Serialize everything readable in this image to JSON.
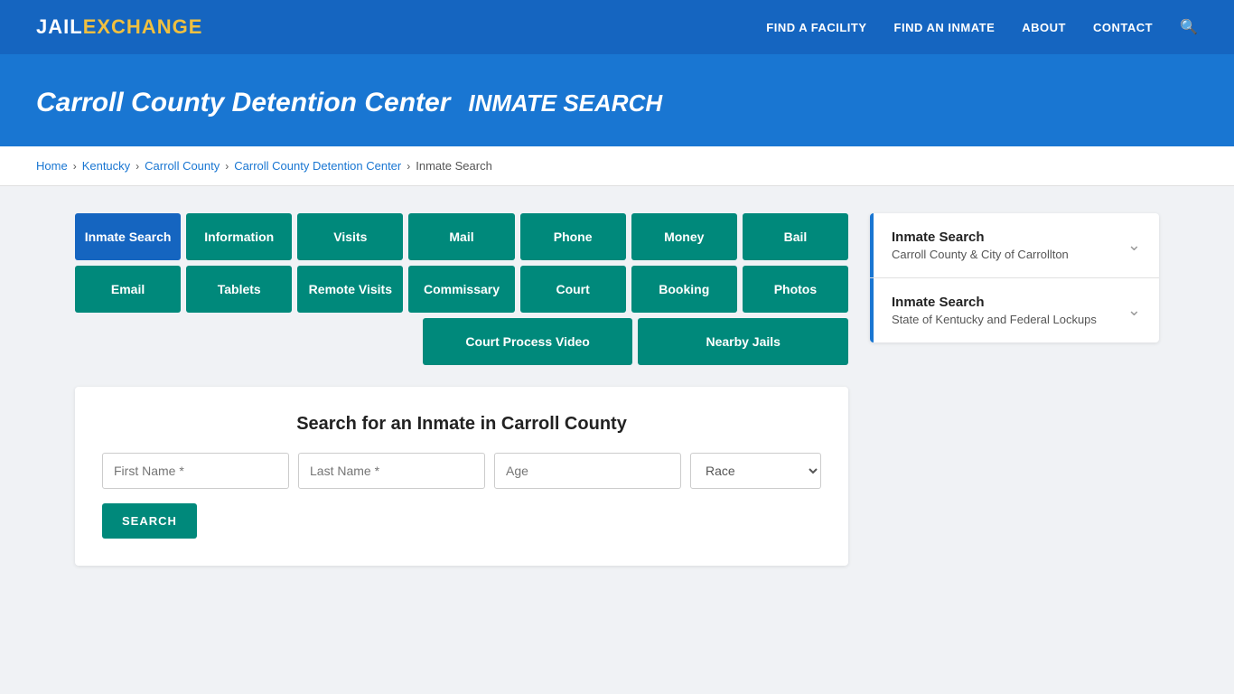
{
  "header": {
    "logo_jail": "JAIL",
    "logo_exchange": "EXCHANGE",
    "nav": [
      {
        "label": "FIND A FACILITY",
        "name": "find-facility"
      },
      {
        "label": "FIND AN INMATE",
        "name": "find-inmate"
      },
      {
        "label": "ABOUT",
        "name": "about"
      },
      {
        "label": "CONTACT",
        "name": "contact"
      }
    ]
  },
  "hero": {
    "facility_name": "Carroll County Detention Center",
    "page_type": "INMATE SEARCH"
  },
  "breadcrumb": {
    "items": [
      {
        "label": "Home",
        "name": "home"
      },
      {
        "label": "Kentucky",
        "name": "kentucky"
      },
      {
        "label": "Carroll County",
        "name": "carroll-county"
      },
      {
        "label": "Carroll County Detention Center",
        "name": "detention-center"
      },
      {
        "label": "Inmate Search",
        "name": "inmate-search-crumb"
      }
    ]
  },
  "nav_buttons": {
    "row1": [
      {
        "label": "Inmate Search",
        "active": true,
        "name": "btn-inmate-search"
      },
      {
        "label": "Information",
        "active": false,
        "name": "btn-information"
      },
      {
        "label": "Visits",
        "active": false,
        "name": "btn-visits"
      },
      {
        "label": "Mail",
        "active": false,
        "name": "btn-mail"
      },
      {
        "label": "Phone",
        "active": false,
        "name": "btn-phone"
      },
      {
        "label": "Money",
        "active": false,
        "name": "btn-money"
      },
      {
        "label": "Bail",
        "active": false,
        "name": "btn-bail"
      }
    ],
    "row2": [
      {
        "label": "Email",
        "active": false,
        "name": "btn-email"
      },
      {
        "label": "Tablets",
        "active": false,
        "name": "btn-tablets"
      },
      {
        "label": "Remote Visits",
        "active": false,
        "name": "btn-remote-visits"
      },
      {
        "label": "Commissary",
        "active": false,
        "name": "btn-commissary"
      },
      {
        "label": "Court",
        "active": false,
        "name": "btn-court"
      },
      {
        "label": "Booking",
        "active": false,
        "name": "btn-booking"
      },
      {
        "label": "Photos",
        "active": false,
        "name": "btn-photos"
      }
    ],
    "row3": [
      {
        "label": "Court Process Video",
        "active": false,
        "name": "btn-court-process-video"
      },
      {
        "label": "Nearby Jails",
        "active": false,
        "name": "btn-nearby-jails"
      }
    ]
  },
  "search_form": {
    "title": "Search for an Inmate in Carroll County",
    "fields": {
      "first_name_placeholder": "First Name *",
      "last_name_placeholder": "Last Name *",
      "age_placeholder": "Age",
      "race_placeholder": "Race"
    },
    "search_button_label": "SEARCH"
  },
  "sidebar": {
    "items": [
      {
        "title": "Inmate Search",
        "subtitle": "Carroll County & City of Carrollton",
        "name": "sidebar-inmate-search-1"
      },
      {
        "title": "Inmate Search",
        "subtitle": "State of Kentucky and Federal Lockups",
        "name": "sidebar-inmate-search-2"
      }
    ]
  }
}
